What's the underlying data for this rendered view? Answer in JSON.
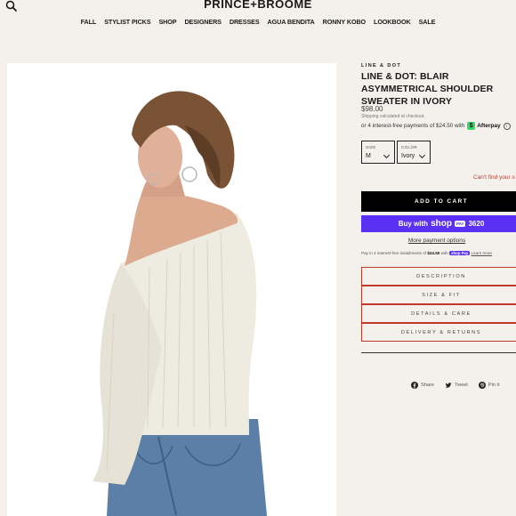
{
  "header": {
    "logo": "PRINCE+BROOME",
    "nav": [
      "FALL",
      "STYLIST PICKS",
      "SHOP",
      "DESIGNERS",
      "DRESSES",
      "AGUA BENDITA",
      "RONNY KOBO",
      "LOOKBOOK",
      "SALE"
    ]
  },
  "product": {
    "brand": "LINE & DOT",
    "title": "LINE & DOT: BLAIR ASYMMETRICAL SHOULDER SWEATER IN IVORY",
    "price": "$98.00",
    "shipping_note": "Shipping calculated at checkout.",
    "afterpay_text": "or 4 interest-free payments of $24.50 with",
    "afterpay_name": "Afterpay",
    "size": {
      "label": "SIZE",
      "value": "M"
    },
    "color": {
      "label": "COLOR",
      "value": "Ivory"
    },
    "size_help": "Can't find your s",
    "add_to_cart": "ADD TO CART",
    "shoppay": {
      "prefix": "Buy with",
      "brand": "shop",
      "badge": "3620"
    },
    "more_options": "More payment options",
    "installments": {
      "prefix": "Pay in 4 interest-free installments of",
      "amount": "$24.50",
      "with": "with",
      "badge": "shop Pay",
      "learn_more": "Learn more"
    },
    "accordions": [
      "DESCRIPTION",
      "SIZE & FIT",
      "DETAILS & CARE",
      "DELIVERY & RETURNS"
    ],
    "share": [
      "Share",
      "Tweet",
      "Pin it"
    ]
  },
  "colors": {
    "background": "#f4f1ec",
    "accent": "#c0392b",
    "shoppay": "#5a31f4",
    "afterpay": "#3ad56b"
  },
  "icons": {
    "search": "search-icon",
    "facebook": "facebook-icon",
    "twitter": "twitter-icon",
    "pinterest": "pinterest-icon"
  }
}
